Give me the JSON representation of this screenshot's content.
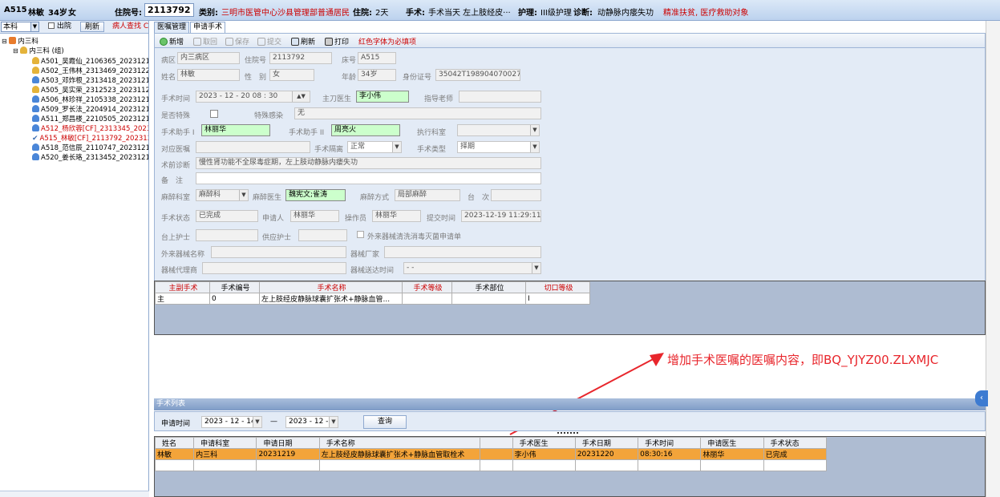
{
  "topbar": {
    "bed": "A515",
    "name": "林敏",
    "age": "34岁",
    "sex": "女",
    "inpatient_label": "住院号:",
    "inpatient_no": "2113792",
    "category_label": "类别:",
    "category_value": "三明市医管中心沙县管理部普通居民",
    "days_label": "住院:",
    "days_value": "2天",
    "surgery_label": "手术:",
    "surgery_value": "手术当天 左上肢经皮···",
    "nursing_label": "护理:",
    "nursing_value": "III级护理",
    "diag_label": "诊断:",
    "diag_value": "动静脉内瘘失功",
    "flag": "精准扶贫, 医疗救助对象"
  },
  "left": {
    "dept_select": "本科",
    "discharge_label": "出院",
    "refresh_label": "刷新",
    "query_label": "病人查找 C",
    "root": "内三科",
    "group": "内三科 (组)",
    "patients": [
      {
        "text": "A501_吴霞仙_2106365_20231218",
        "color": "normal",
        "icon": "#e4b33a"
      },
      {
        "text": "A502_王伟林_2313469_20231220",
        "color": "normal",
        "icon": "#e4b33a"
      },
      {
        "text": "A503_邓炸根_2313418_20231219",
        "color": "normal",
        "icon": "#4a86d8"
      },
      {
        "text": "A505_吴实荣_2312523_20231127",
        "color": "normal",
        "icon": "#e4b33a"
      },
      {
        "text": "A506_林珍祥_2105338_20231218",
        "color": "normal",
        "icon": "#4a86d8"
      },
      {
        "text": "A509_罗长法_2204914_20231218",
        "color": "normal",
        "icon": "#4a86d8"
      },
      {
        "text": "A511_郑昌楼_2210505_20231217",
        "color": "normal",
        "icon": "#4a86d8"
      },
      {
        "text": "A512_杨欣蓉[CF]_2313345_2023",
        "color": "red",
        "icon": "#4a86d8"
      },
      {
        "text": "A515_林敏[CF]_2113792_202312",
        "color": "red",
        "icon": "check"
      },
      {
        "text": "A518_范信辰_2110747_20231218",
        "color": "normal",
        "icon": "#4a86d8"
      },
      {
        "text": "A520_姜长珞_2313452_20231219",
        "color": "normal",
        "icon": "#4a86d8"
      }
    ]
  },
  "tabs": [
    "医嘱管理",
    "申请手术"
  ],
  "toolbar": {
    "new": "新增",
    "cancel": "取回",
    "save": "保存",
    "submit": "提交",
    "refresh": "刷新",
    "print": "打印",
    "required_note": "红色字体为必填项"
  },
  "form": {
    "ward_label": "病区",
    "ward": "内三病区",
    "inpatient_label": "住院号",
    "inpatient": "2113792",
    "bed_label": "床号",
    "bed": "A515",
    "name_label": "姓名",
    "name": "林敏",
    "sex_label": "性　别",
    "sex": "女",
    "age_label": "年龄",
    "age": "34岁",
    "id_label": "身份证号",
    "id": "35042T198904070027",
    "time_label": "手术时间",
    "time": "2023 - 12 - 20   08 : 30",
    "surgeon_label": "主刀医生",
    "surgeon": "李小伟",
    "mentor_label": "指导老师",
    "mentor": "",
    "special_label": "是否特殊",
    "infection_label": "特殊感染",
    "infection": "无",
    "assist1_label": "手术助手 I",
    "assist1": "林丽华",
    "assist2_label": "手术助手 II",
    "assist2": "周亮火",
    "exec_dept_label": "执行科室",
    "exec_dept": "",
    "order_label": "对应医嘱",
    "order": "",
    "isolation_label": "手术隔离",
    "isolation": "正常",
    "type_label": "手术类型",
    "type": "择期",
    "preop_diag_label": "术前诊断",
    "preop_diag": "慢性肾功能不全尿毒症期，左上肢动静脉内瘘失功",
    "remark_label": "备　注",
    "remark": "",
    "anes_dept_label": "麻醉科室",
    "anes_dept": "麻醉科",
    "anes_doc_label": "麻醉医生",
    "anes_doc": "魏宪文;雀涛",
    "anes_method_label": "麻醉方式",
    "anes_method": "局部麻醉",
    "table_no_label": "台　次",
    "table_no": "",
    "status_label": "手术状态",
    "status": "已完成",
    "applicant_label": "申请人",
    "applicant": "林丽华",
    "operator_label": "操作员",
    "operator": "林丽华",
    "submit_time_label": "提交时间",
    "submit_time": "2023-12-19 11:29:11",
    "nurse_label": "台上护士",
    "nurse": "",
    "supply_nurse_label": "供应护士",
    "supply_nurse": "",
    "external_check_label": "外来器械清洗消毒灭菌申请单",
    "ext_name_label": "外来器械名称",
    "ext_name": "",
    "maker_label": "器械厂家",
    "maker": "",
    "agent_label": "器械代理商",
    "agent": "",
    "delivery_label": "器械送达时间",
    "delivery": "-  -"
  },
  "grid1": {
    "columns": [
      {
        "label": "主副手术",
        "red": true
      },
      {
        "label": "手术编号",
        "red": false
      },
      {
        "label": "手术名称",
        "red": true
      },
      {
        "label": "手术等级",
        "red": true
      },
      {
        "label": "手术部位",
        "red": false
      },
      {
        "label": "切口等级",
        "red": true
      }
    ],
    "rows": [
      [
        "主",
        "0",
        "左上肢经皮静脉球囊扩张术+静脉血管...",
        "",
        "",
        "I"
      ]
    ]
  },
  "annotation": "增加手术医嘱的医嘱内容，即BQ_YJYZ00.ZLXMJC",
  "list": {
    "title": "手术列表",
    "apply_time_label": "申请时间",
    "date_from": "2023 - 12 - 14",
    "sep": "—",
    "date_to": "2023 - 12 - 21",
    "query": "查询"
  },
  "grid2": {
    "columns": [
      "姓名",
      "申请科室",
      "申请日期",
      "手术名称",
      "",
      "手术医生",
      "手术日期",
      "手术时间",
      "申请医生",
      "手术状态"
    ],
    "rows": [
      [
        "林敏",
        "内三科",
        "20231219",
        "左上肢经皮静脉球囊扩张术+静脉血管取栓术",
        "",
        "李小伟",
        "20231220",
        "08:30:16",
        "林丽华",
        "已完成"
      ]
    ]
  },
  "colors": {
    "annotation": "#e8262c",
    "highlight": "#f3a43a",
    "required": "#cc0000"
  }
}
